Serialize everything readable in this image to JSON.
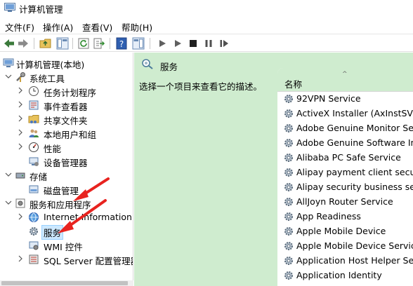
{
  "window": {
    "title": "计算机管理"
  },
  "menu": [
    {
      "label": "文件(F)"
    },
    {
      "label": "操作(A)"
    },
    {
      "label": "查看(V)"
    },
    {
      "label": "帮助(H)"
    }
  ],
  "tree": {
    "root": "计算机管理(本地)",
    "system_tools": "系统工具",
    "task_scheduler": "任务计划程序",
    "event_viewer": "事件查看器",
    "shared_folders": "共享文件夹",
    "local_users": "本地用户和组",
    "performance": "性能",
    "device_manager": "设备管理器",
    "storage": "存储",
    "disk_management": "磁盘管理",
    "services_apps": "服务和应用程序",
    "iis": "Internet Information S",
    "services": "服务",
    "wmi": "WMI 控件",
    "sql_server": "SQL Server 配置管理器"
  },
  "main": {
    "header": "服务",
    "hint": "选择一个项目来查看它的描述。",
    "column_name": "名称",
    "sort_glyph": "^",
    "services": [
      "92VPN Service",
      "ActiveX Installer (AxInstSV)",
      "Adobe Genuine Monitor Service",
      "Adobe Genuine Software Integrity Service",
      "Alibaba PC Safe Service",
      "Alipay payment client security service",
      "Alipay security business service",
      "AllJoyn Router Service",
      "App Readiness",
      "Apple Mobile Device",
      "Apple Mobile Device Service",
      "Application Host Helper Service",
      "Application Identity"
    ]
  },
  "colors": {
    "accent_green": "#cfeccf",
    "annotation_arrow": "#e8231f",
    "selection": "#cce8ff"
  }
}
